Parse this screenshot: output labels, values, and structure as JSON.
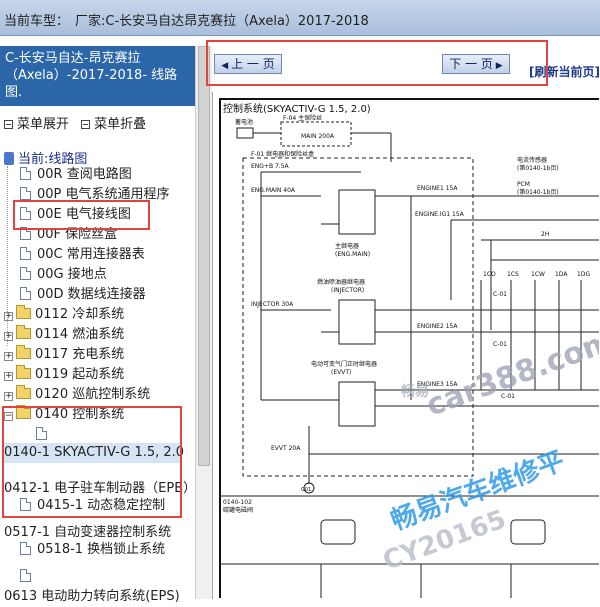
{
  "topbar": {
    "prefix": "当前车型：",
    "value": "厂家:C-长安马自达昂克赛拉（Axela）2017-2018"
  },
  "left": {
    "header": "C-长安马自达-昂克赛拉（Axela）-2017-2018- 线路图.",
    "menu_expand": "菜单展开",
    "menu_collapse": "菜单折叠",
    "current": "当前:线路图",
    "tree": [
      "00R 查阅电路图",
      "00P 电气系统通用程序",
      "00E 电气接线图",
      "00F 保险丝盒",
      "00C 常用连接器表",
      "00G 接地点",
      "00D 数据线连接器",
      "0112 冷却系统",
      "0114 燃油系统",
      "0117 充电系统",
      "0119 起动系统",
      "0120 巡航控制系统",
      "0140 控制系统",
      "0140-1 SKYACTIV-G 1.5, 2.0",
      "0412-1 电子驻车制动器（EPB）",
      "0415-1 动态稳定控制",
      "0517-1 自动变速器控制系统",
      "0518-1 换档锁止系统",
      "0613 电动助力转向系统(EPS)"
    ]
  },
  "nav": {
    "prev": "上 一 页",
    "next": "下 一 页",
    "refresh": "[刷新当前页]"
  },
  "diagram": {
    "title": "控制系统(SKYACTIV-G 1.5, 2.0)",
    "labels": {
      "battery": "蓄电池",
      "f04": "F-04 主保险丝",
      "main200": "MAIN 200A",
      "f01": "F-01 继电器和保险丝盒",
      "eng75": "ENG+B 7.5A",
      "engmain": "ENG.MAIN 40A",
      "engine1": "ENGINE1 15A",
      "mainrelay": "主继电器",
      "engmainrelay": "(ENG.MAIN)",
      "engineig1": "ENGINE.IG1 15A",
      "pcm": "PCM",
      "pcmref": "(第0140-1b页)",
      "elecsensor": "电流传感器",
      "pcmref2": "(第0140-1b页)",
      "injrelay": "燃油喷油器继电器",
      "injrelay2": "(INJECTOR)",
      "injector": "INJECTOR 30A",
      "engine2": "ENGINE2 15A",
      "engine3": "ENGINE3 15A",
      "evvtrelay": "电动可变气门正时继电器",
      "evvtrelay2": "(EVVT)",
      "evvt": "EVVT 20A",
      "c01a": "C-01",
      "c01b": "C-01",
      "c01c": "C-01",
      "g01": "G01",
      "conn": "0140-102",
      "connname": "碳罐电磁阀",
      "h2": "2H",
      "pinheads": [
        "1CO",
        "1CS",
        "1CW",
        "1DA",
        "1DG"
      ],
      "wm1": "畅易",
      "wm2": "car388.com",
      "wm3": "畅易汽车维修平",
      "wm4": "CY20165"
    }
  }
}
